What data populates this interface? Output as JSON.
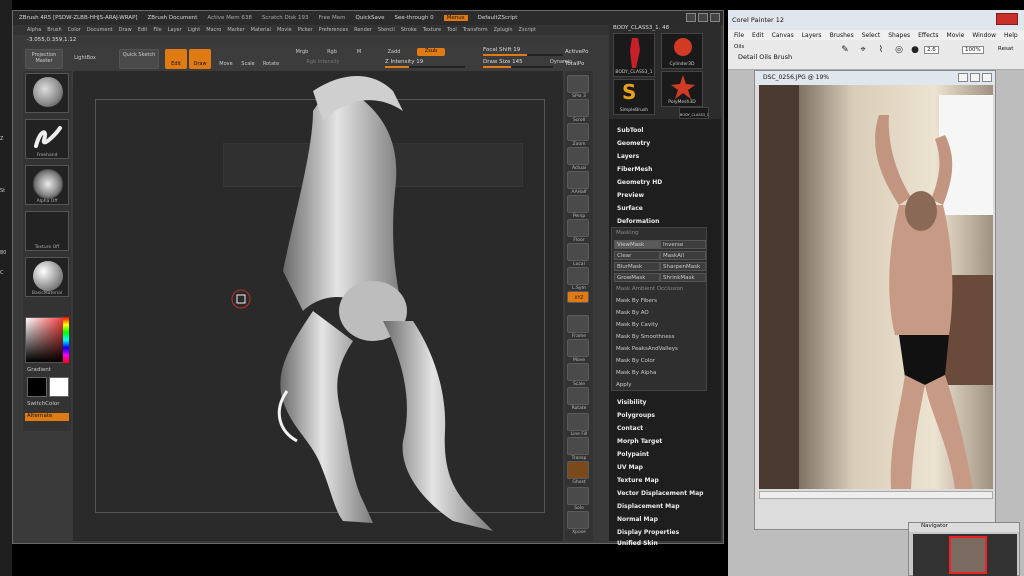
{
  "desktop_strip": {
    "ticks": [
      "Z",
      "St",
      "80",
      "C"
    ]
  },
  "zbrush": {
    "title_bar": {
      "app": "ZBrush 4R5 [PSDW-ZLBB-HHJS-ARAJ-WRAP]",
      "doc": "ZBrush Document",
      "active_mem": "Active Mem 638",
      "scratch": "Scratch Disk 193",
      "free": "Free Mem",
      "quicksave": "QuickSave",
      "see_through": "See-through 0",
      "menus": "Menus",
      "script": "DefaultZScript"
    },
    "menubar": [
      "Alpha",
      "Brush",
      "Color",
      "Document",
      "Draw",
      "Edit",
      "File",
      "Layer",
      "Light",
      "Macro",
      "Marker",
      "Material",
      "Movie",
      "Picker",
      "Preferences",
      "Render",
      "Stencil",
      "Stroke",
      "Texture",
      "Tool",
      "Transform",
      "Zplugin",
      "Zscript"
    ],
    "coords": "-3.055,0.359,1.12",
    "toolbar": {
      "projection_master": "Projection Master",
      "lightbox": "LightBox",
      "quick_sketch": "Quick Sketch",
      "edit": "Edit",
      "draw": "Draw",
      "move": "Move",
      "scale": "Scale",
      "rotate": "Rotate",
      "mrgb": "Mrgb",
      "rgb": "Rgb",
      "m": "M",
      "rgb_intensity": "Rgb Intensity",
      "zadd": "Zadd",
      "zsub": "Zsub",
      "z_intensity": "Z Intensity 19",
      "focal_shift": "Focal Shift 19",
      "draw_size": "Draw Size 145",
      "dynamic": "Dynamic",
      "active_points": "ActivePo",
      "total_points": "TotalPo"
    },
    "left_tray": {
      "thumb_captions": [
        "",
        "Freehand",
        "Alpha Off",
        "Texture Off",
        "BasicMaterial"
      ],
      "gradient": "Gradient",
      "switch_color": "SwitchColor",
      "alternate": "Alternate"
    },
    "right_shelf": [
      "SPix 3",
      "Scroll",
      "Zoom",
      "Actual",
      "AAHalf",
      "Persp",
      "Floor",
      "Local",
      "L.Sym",
      "XYZ",
      "Frame",
      "Move",
      "Scale",
      "Rotate",
      "Line Fill",
      "Transp",
      "Ghost",
      "Solo",
      "Xpose"
    ],
    "subtool_panel": {
      "header": "BODY_CLASS3_1. 48",
      "thumbs": [
        {
          "caption": "BODY_CLASS3_1",
          "color": "#c8202a"
        },
        {
          "caption": "Cylinder3D",
          "color": "#d33a24"
        },
        {
          "caption": "SimpleBrush",
          "color": "#e7a11a"
        },
        {
          "caption": "PolyMesh3D",
          "color": "#d33a24"
        },
        {
          "caption": "BODY_CLASS3_1",
          "color": "#b21e22"
        }
      ],
      "items_top": [
        "SubTool",
        "Geometry",
        "Layers",
        "FiberMesh",
        "Geometry HD",
        "Preview",
        "Surface",
        "Deformation"
      ],
      "masking": {
        "title": "Masking",
        "buttons": [
          [
            "ViewMask",
            "Inverse"
          ],
          [
            "Clear",
            "MaskAll"
          ],
          [
            "BlurMask",
            "SharpenMask"
          ],
          [
            "GrowMask",
            "ShrinkMask"
          ]
        ],
        "sub_section": "Mask Ambient Occlusion",
        "items": [
          "Mask By Fibers",
          "Mask By AO",
          "Mask By Cavity",
          "Mask By Smoothness",
          "Mask PeaksAndValleys",
          "Mask By Color",
          "Mask By Alpha",
          "Apply"
        ]
      },
      "items_bottom": [
        "Visibility",
        "Polygroups",
        "Contact",
        "Morph Target",
        "Polypaint",
        "UV Map",
        "Texture Map",
        "Vector Displacement Map",
        "Displacement Map",
        "Normal Map",
        "Display Properties",
        "Unified Skin"
      ]
    }
  },
  "painter": {
    "title": "Corel Painter 12",
    "menubar": [
      "File",
      "Edit",
      "Canvas",
      "Layers",
      "Brushes",
      "Select",
      "Shapes",
      "Effects",
      "Movie",
      "Window",
      "Help"
    ],
    "brush_category": "Oils",
    "brush_variant": "Detail Oils Brush",
    "size": "2.6",
    "opacity": "100%",
    "opacity_label": "Resat",
    "doc_title": "DSC_0256.JPG @ 19%",
    "navigator": "Navigator"
  },
  "colors": {
    "accent": "#e07a13",
    "zbrush_bg": "#3a3a3a",
    "panel_bg": "#1e1e1e"
  }
}
